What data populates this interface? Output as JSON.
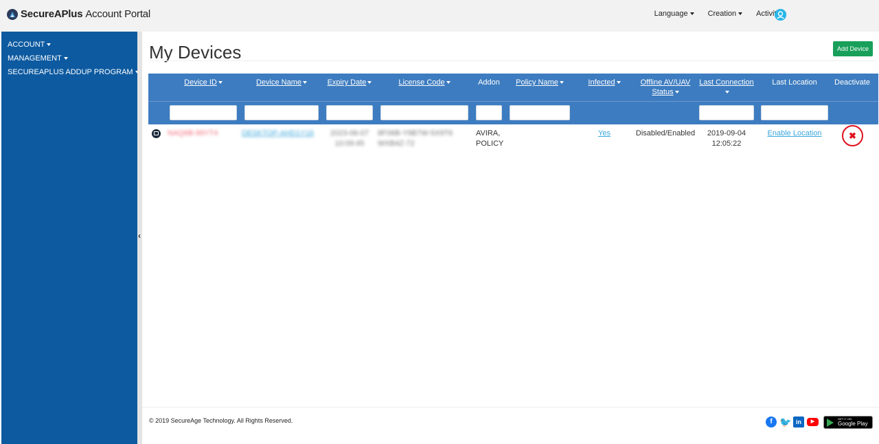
{
  "brand": {
    "name_bold": "SecureAPlus",
    "name_rest": "Account Portal"
  },
  "topnav": {
    "items": [
      "Language",
      "Creation",
      "Activity"
    ],
    "icon": "user-avatar-icon"
  },
  "sidebar": {
    "items": [
      "ACCOUNT",
      "MANAGEMENT",
      "SECUREAPLUS ADDUP PROGRAM"
    ]
  },
  "page": {
    "title": "My Devices",
    "add_button": "Add Device"
  },
  "table": {
    "columns": [
      {
        "label": "Device ID",
        "sortable": true
      },
      {
        "label": "Device Name",
        "sortable": true
      },
      {
        "label": "Expiry Date",
        "sortable": true
      },
      {
        "label": "License Code",
        "sortable": true
      },
      {
        "label": "Addon",
        "sortable": false
      },
      {
        "label": "Policy Name",
        "sortable": true
      },
      {
        "label": "Infected",
        "sortable": true
      },
      {
        "label": "Offline AV/UAV Status",
        "label_line1": "Offline AV/UAV",
        "label_line2": "Status",
        "sortable": true
      },
      {
        "label": "Last Connection",
        "sortable": true
      },
      {
        "label": "Last Location",
        "sortable": false
      },
      {
        "label": "Deactivate",
        "sortable": false
      }
    ],
    "rows": [
      {
        "device_id": "NAQ6B-99YT4",
        "device_name": "DESKTOP-AHD1Y16",
        "expiry_line1": "2023-06-07",
        "expiry_line2": "10:09:45",
        "license_line1": "8F06B-Y9B7W-5X9T6",
        "license_line2": "WXB4Z-72",
        "addon_line1": "AVIRA,",
        "addon_line2": "POLICY",
        "policy_name": "",
        "infected": "Yes",
        "offline_status": "Disabled/Enabled",
        "last_connection_date": "2019-09-04",
        "last_connection_time": "12:05:22",
        "last_location": "Enable Location",
        "deactivate_icon": "close-circle-icon"
      }
    ]
  },
  "footer": {
    "copyright": "© 2019 SecureAge Technology. All Rights Reserved.",
    "socials": [
      "facebook-icon",
      "twitter-icon",
      "linkedin-icon",
      "youtube-icon"
    ],
    "store_badge_small": "GET IT ON",
    "store_badge_big": "Google Play"
  },
  "colors": {
    "sidebar": "#0d5aa0",
    "table_header": "#3d7cc0",
    "add_button": "#18a05a",
    "deactivate": "#e0101e",
    "link": "#3aa6db"
  }
}
